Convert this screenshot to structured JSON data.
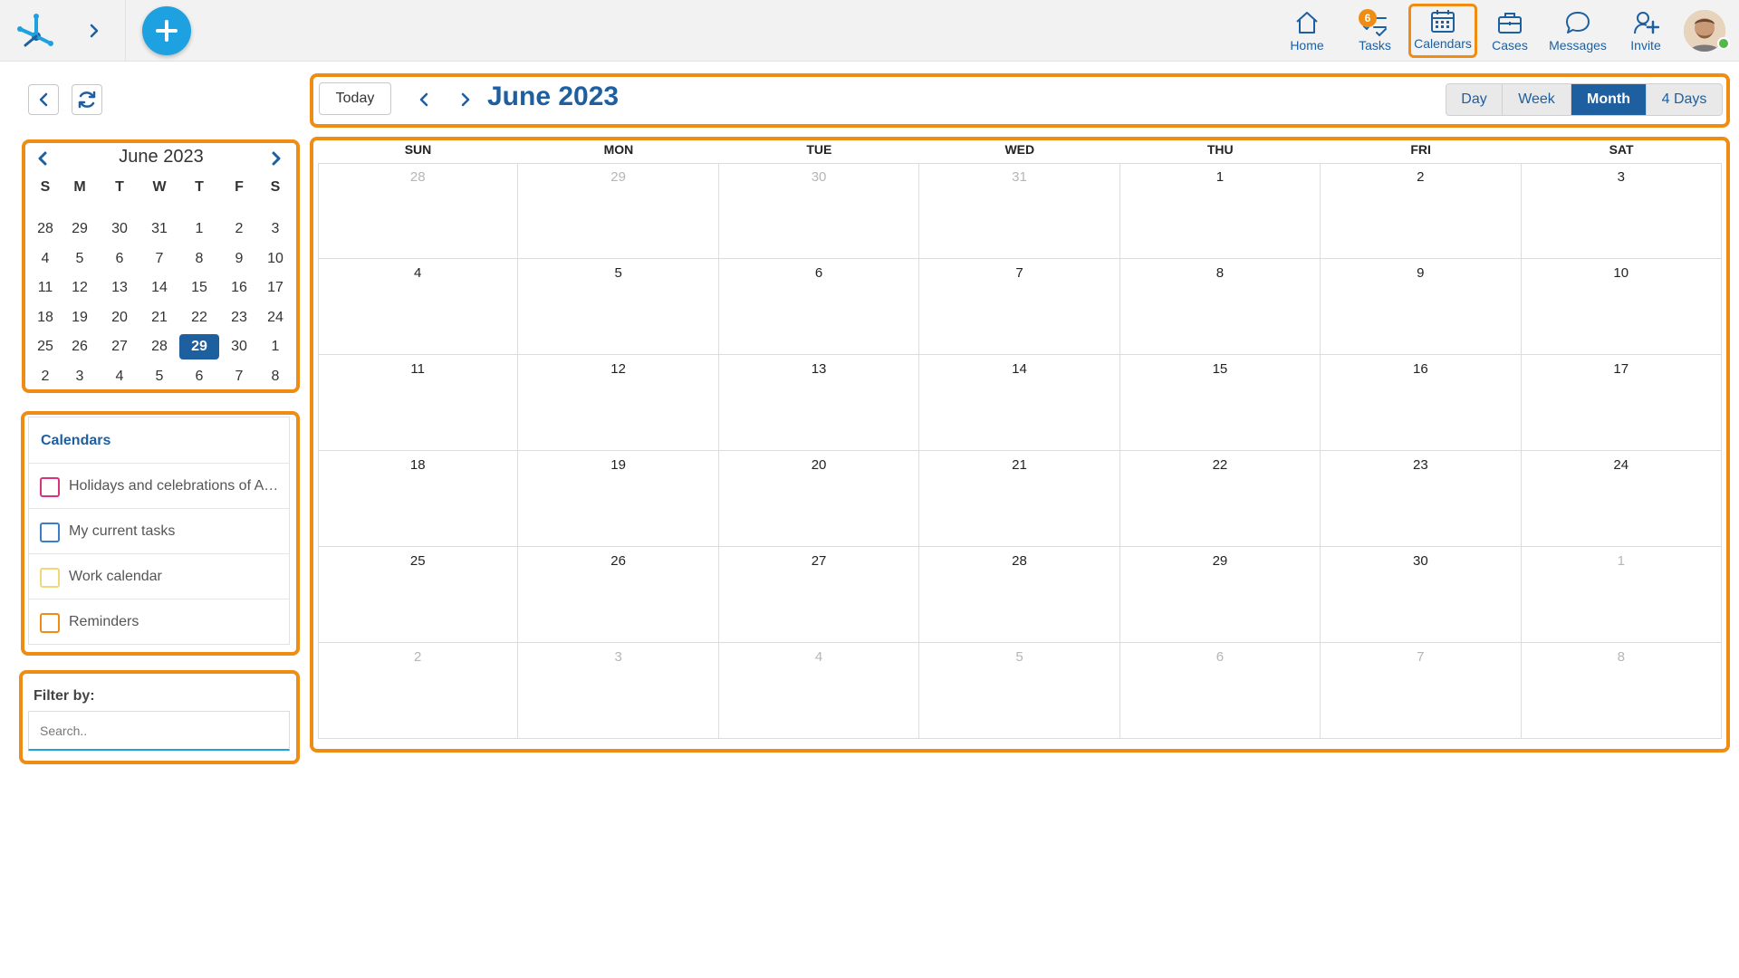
{
  "app": {
    "nav": [
      {
        "key": "home",
        "label": "Home",
        "icon": "home-icon"
      },
      {
        "key": "tasks",
        "label": "Tasks",
        "icon": "tasks-icon",
        "badge": "6"
      },
      {
        "key": "calendars",
        "label": "Calendars",
        "icon": "calendar-icon",
        "active": true
      },
      {
        "key": "cases",
        "label": "Cases",
        "icon": "briefcase-icon"
      },
      {
        "key": "messages",
        "label": "Messages",
        "icon": "chat-bubble-icon"
      },
      {
        "key": "invite",
        "label": "Invite",
        "icon": "add-user-icon"
      }
    ],
    "accent_color": "#1e5fa0",
    "highlight_color": "#ee8c13",
    "add_button_color": "#1da1e0"
  },
  "mini_calendar": {
    "title": "June 2023",
    "weekdays": [
      "S",
      "M",
      "T",
      "W",
      "T",
      "F",
      "S"
    ],
    "weeks": [
      [
        "28",
        "29",
        "30",
        "31",
        "1",
        "2",
        "3"
      ],
      [
        "4",
        "5",
        "6",
        "7",
        "8",
        "9",
        "10"
      ],
      [
        "11",
        "12",
        "13",
        "14",
        "15",
        "16",
        "17"
      ],
      [
        "18",
        "19",
        "20",
        "21",
        "22",
        "23",
        "24"
      ],
      [
        "25",
        "26",
        "27",
        "28",
        "29",
        "30",
        "1"
      ],
      [
        "2",
        "3",
        "4",
        "5",
        "6",
        "7",
        "8"
      ]
    ],
    "selected": "29"
  },
  "calendars_panel": {
    "title": "Calendars",
    "items": [
      {
        "label": "Holidays and celebrations of Argentina",
        "color": "#d8327b"
      },
      {
        "label": "My current tasks",
        "color": "#3a7dc9"
      },
      {
        "label": "Work calendar",
        "color": "#f3d67a"
      },
      {
        "label": "Reminders",
        "color": "#ee8c13"
      }
    ]
  },
  "filter": {
    "title": "Filter by:",
    "placeholder": "Search.."
  },
  "toolbar": {
    "today_label": "Today",
    "title": "June 2023",
    "views": [
      {
        "label": "Day",
        "active": false
      },
      {
        "label": "Week",
        "active": false
      },
      {
        "label": "Month",
        "active": true
      },
      {
        "label": "4 Days",
        "active": false
      }
    ]
  },
  "month_grid": {
    "weekdays": [
      "SUN",
      "MON",
      "TUE",
      "WED",
      "THU",
      "FRI",
      "SAT"
    ],
    "weeks": [
      [
        {
          "d": "28",
          "dim": true
        },
        {
          "d": "29",
          "dim": true
        },
        {
          "d": "30",
          "dim": true
        },
        {
          "d": "31",
          "dim": true
        },
        {
          "d": "1"
        },
        {
          "d": "2"
        },
        {
          "d": "3"
        }
      ],
      [
        {
          "d": "4"
        },
        {
          "d": "5"
        },
        {
          "d": "6"
        },
        {
          "d": "7"
        },
        {
          "d": "8"
        },
        {
          "d": "9"
        },
        {
          "d": "10"
        }
      ],
      [
        {
          "d": "11"
        },
        {
          "d": "12"
        },
        {
          "d": "13"
        },
        {
          "d": "14"
        },
        {
          "d": "15"
        },
        {
          "d": "16"
        },
        {
          "d": "17"
        }
      ],
      [
        {
          "d": "18"
        },
        {
          "d": "19"
        },
        {
          "d": "20"
        },
        {
          "d": "21"
        },
        {
          "d": "22"
        },
        {
          "d": "23"
        },
        {
          "d": "24"
        }
      ],
      [
        {
          "d": "25"
        },
        {
          "d": "26"
        },
        {
          "d": "27"
        },
        {
          "d": "28"
        },
        {
          "d": "29"
        },
        {
          "d": "30"
        },
        {
          "d": "1",
          "dim": true
        }
      ],
      [
        {
          "d": "2",
          "dim": true
        },
        {
          "d": "3",
          "dim": true
        },
        {
          "d": "4",
          "dim": true
        },
        {
          "d": "5",
          "dim": true
        },
        {
          "d": "6",
          "dim": true
        },
        {
          "d": "7",
          "dim": true
        },
        {
          "d": "8",
          "dim": true
        }
      ]
    ]
  }
}
